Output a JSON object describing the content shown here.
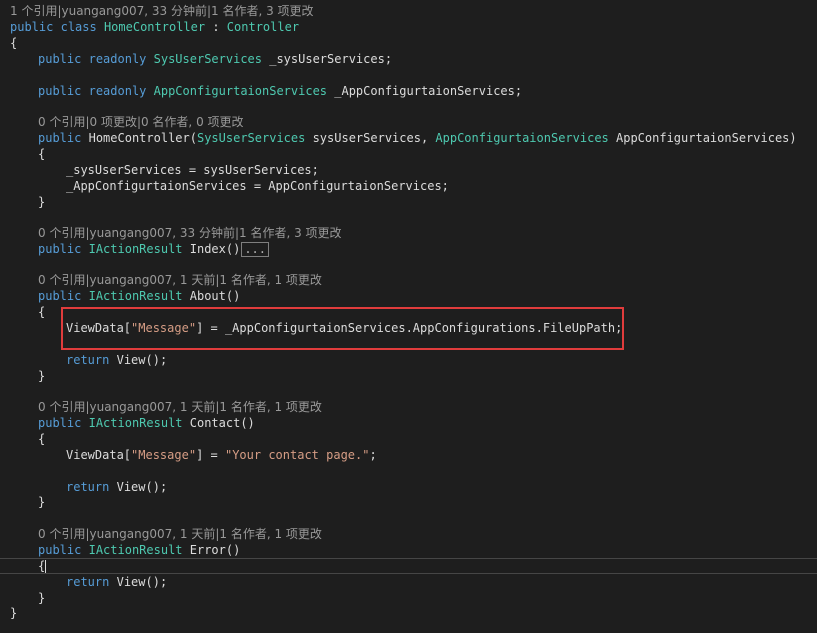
{
  "colors": {
    "background": "#1e1e1e",
    "keyword": "#569cd6",
    "type": "#4ec9b0",
    "string": "#d69d85",
    "text": "#dcdcdc",
    "lens": "#999999",
    "highlight_box": "#e03c3c"
  },
  "code": {
    "lens_class": "1 个引用|yuangang007, 33 分钟前|1 名作者, 3 项更改",
    "kw_public": "public",
    "kw_class": "class",
    "kw_readonly": "readonly",
    "class_name": "HomeController",
    "colon": " : ",
    "base_class": "Controller",
    "brace_open": "{",
    "brace_close": "}",
    "field1_type": "SysUserServices",
    "field1_name": "_sysUserServices;",
    "field2_type": "AppConfigurtaionServices",
    "field2_name": "_AppConfigurtaionServices;",
    "lens_ctor": "0 个引用|0 项更改|0 名作者, 0 项更改",
    "ctor_name": "HomeController(",
    "ctor_param1_type": "SysUserServices",
    "ctor_param1_name": " sysUserServices, ",
    "ctor_param2_type": "AppConfigurtaionServices",
    "ctor_param2_name": " AppConfigurtaionServices)",
    "ctor_assign1": "_sysUserServices = sysUserServices;",
    "ctor_assign2": "_AppConfigurtaionServices = AppConfigurtaionServices;",
    "lens_index": "0 个引用|yuangang007, 33 分钟前|1 名作者, 3 项更改",
    "action_type": "IActionResult",
    "index_name": "Index()",
    "collapsed_marker": "...",
    "lens_about": "0 个引用|yuangang007, 1 天前|1 名作者, 1 项更改",
    "about_name": "About()",
    "viewdata_open": "ViewData[",
    "message_key": "\"Message\"",
    "about_assign_rest": "] = _AppConfigurtaionServices.AppConfigurations.FileUpPath;",
    "kw_return": "return",
    "return_view": "View();",
    "lens_contact": "0 个引用|yuangang007, 1 天前|1 名作者, 1 项更改",
    "contact_name": "Contact()",
    "viewdata_close_eq": "] = ",
    "contact_string": "\"Your contact page.\"",
    "semicolon": ";",
    "lens_error": "0 个引用|yuangang007, 1 天前|1 名作者, 1 项更改",
    "error_name": "Error()"
  }
}
